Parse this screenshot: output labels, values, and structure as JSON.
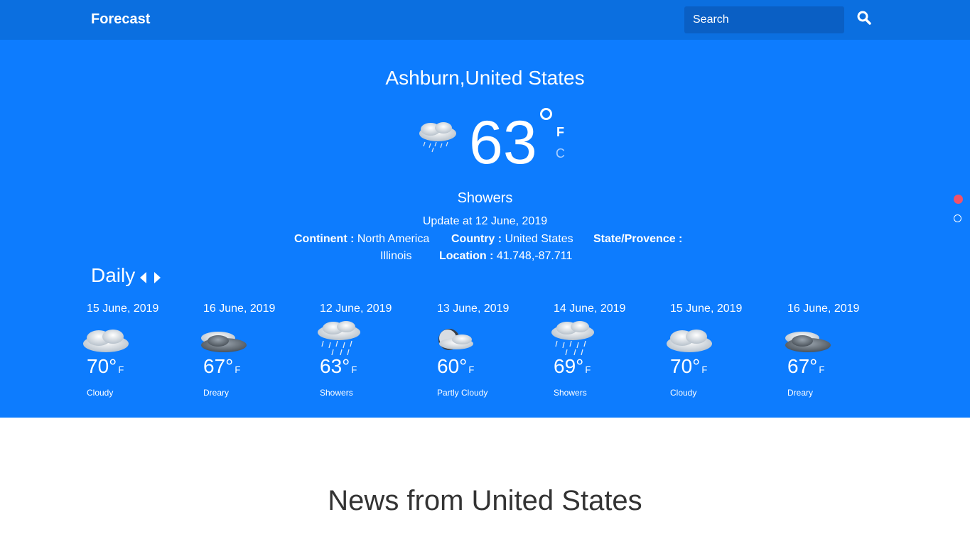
{
  "navbar": {
    "brand": "Forecast",
    "search_placeholder": "Search",
    "search_icon": "search-icon"
  },
  "current": {
    "location": "Ashburn,United States",
    "temperature": "63",
    "unit_f": "F",
    "unit_c": "C",
    "condition": "Showers",
    "update": "Update at 12 June, 2019",
    "icon": "showers-cloud-icon",
    "continent_label": "Continent :",
    "continent_value": "North America",
    "country_label": "Country :",
    "country_value": "United States",
    "state_label": "State/Provence :",
    "state_value": "Illinois",
    "location_label": "Location :",
    "location_value": "41.748,-87.711"
  },
  "daily": {
    "title": "Daily",
    "prev_icon": "caret-left-icon",
    "next_icon": "caret-right-icon",
    "days": [
      {
        "date": "15 June, 2019",
        "temp": "70°",
        "unit": "F",
        "condition": "Cloudy",
        "icon": "cloudy-icon"
      },
      {
        "date": "16 June, 2019",
        "temp": "67°",
        "unit": "F",
        "condition": "Dreary",
        "icon": "dreary-icon"
      },
      {
        "date": "12 June, 2019",
        "temp": "63°",
        "unit": "F",
        "condition": "Showers",
        "icon": "showers-icon"
      },
      {
        "date": "13 June, 2019",
        "temp": "60°",
        "unit": "F",
        "condition": "Partly Cloudy",
        "icon": "partly-cloudy-night-icon"
      },
      {
        "date": "14 June, 2019",
        "temp": "69°",
        "unit": "F",
        "condition": "Showers",
        "icon": "showers-icon"
      },
      {
        "date": "15 June, 2019",
        "temp": "70°",
        "unit": "F",
        "condition": "Cloudy",
        "icon": "cloudy-icon"
      },
      {
        "date": "16 June, 2019",
        "temp": "67°",
        "unit": "F",
        "condition": "Dreary",
        "icon": "dreary-icon"
      }
    ]
  },
  "news": {
    "title": "News from United States"
  },
  "colors": {
    "navbar": "#0b6fe0",
    "hero": "#0d7cfe",
    "dot_active": "#f0526a"
  }
}
